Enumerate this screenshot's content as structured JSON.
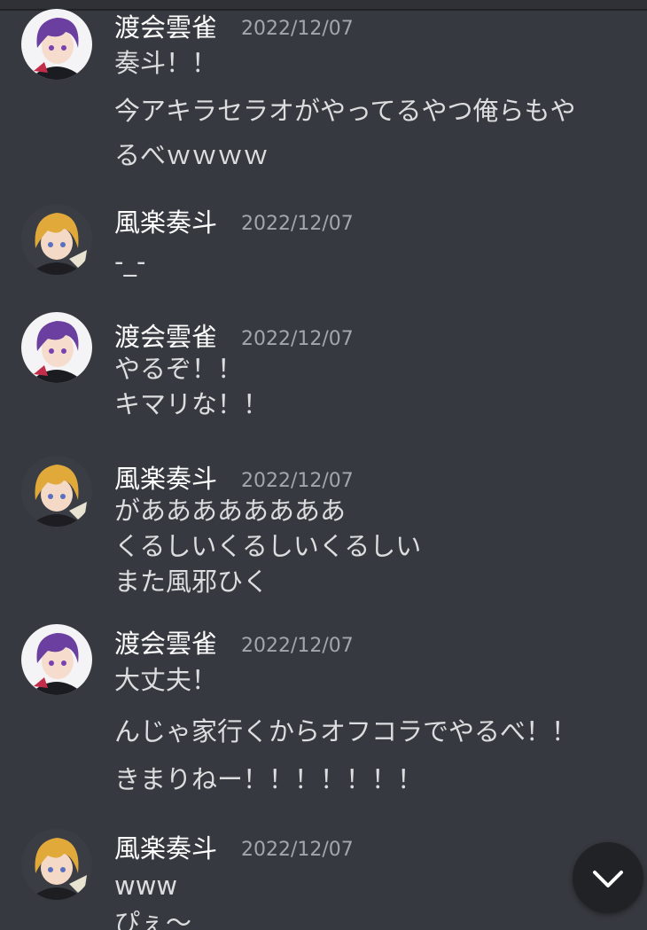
{
  "messages": [
    {
      "user": "渡会雲雀",
      "avatar": "purple-hair-avatar",
      "time": "2022/12/07",
      "lines": [
        "奏斗！！",
        "今アキラセラオがやってるやつ俺らもや",
        "るべｗｗｗｗ"
      ]
    },
    {
      "user": "風楽奏斗",
      "avatar": "blonde-hair-avatar",
      "time": "2022/12/07",
      "lines": [
        "-_-"
      ]
    },
    {
      "user": "渡会雲雀",
      "avatar": "purple-hair-avatar",
      "time": "2022/12/07",
      "lines": [
        "やるぞ！！",
        "キマリな！！"
      ]
    },
    {
      "user": "風楽奏斗",
      "avatar": "blonde-hair-avatar",
      "time": "2022/12/07",
      "lines": [
        "がああああああああ",
        "くるしいくるしいくるしい",
        "また風邪ひく"
      ]
    },
    {
      "user": "渡会雲雀",
      "avatar": "purple-hair-avatar",
      "time": "2022/12/07",
      "lines": [
        "大丈夫！",
        "んじゃ家行くからオフコラでやるべ！！",
        "きまりねー！！！！！！！"
      ]
    },
    {
      "user": "風楽奏斗",
      "avatar": "blonde-hair-avatar",
      "time": "2022/12/07",
      "lines": [
        "www",
        "ぴぇ〜"
      ]
    }
  ],
  "scroll_button": {
    "icon": "chevron-down-icon"
  },
  "colors": {
    "background": "#36393f",
    "username": "#ffffff",
    "timestamp": "#a3a6aa",
    "message_text": "#dcddde",
    "purple_hair": "#6b3fa0",
    "blonde_hair": "#e0a93a"
  }
}
